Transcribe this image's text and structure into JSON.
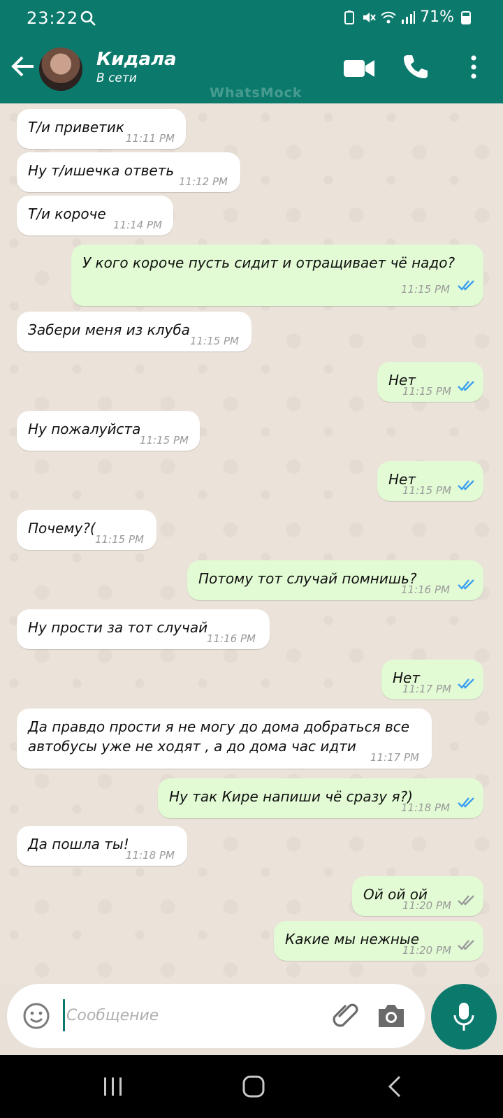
{
  "status_bar": {
    "time": "23:22",
    "battery": "71%",
    "icons": [
      "search-icon",
      "battery-saver-icon",
      "mute-icon",
      "wifi-icon",
      "signal-icon",
      "battery-icon"
    ]
  },
  "header": {
    "contact_name": "Кидала",
    "contact_status": "В сети",
    "watermark": "WhatsMock",
    "icons": [
      "back-arrow-icon",
      "video-call-icon",
      "phone-icon",
      "more-vert-icon"
    ]
  },
  "messages": [
    {
      "dir": "in",
      "text": "Т/и приветик",
      "time": "11:11 PM"
    },
    {
      "dir": "in",
      "text": "Ну т/ишечка ответь",
      "time": "11:12 PM"
    },
    {
      "dir": "in",
      "text": "Т/и короче",
      "time": "11:14 PM"
    },
    {
      "dir": "out",
      "text": "У кого короче пусть сидит и отращивает чё надо?",
      "time": "11:15 PM",
      "read": true
    },
    {
      "dir": "in",
      "text": "Забери меня из клуба",
      "time": "11:15 PM"
    },
    {
      "dir": "out",
      "text": "Нет",
      "time": "11:15 PM",
      "read": true
    },
    {
      "dir": "in",
      "text": "Ну пожалуйста",
      "time": "11:15 PM"
    },
    {
      "dir": "out",
      "text": "Нет",
      "time": "11:15 PM",
      "read": true
    },
    {
      "dir": "in",
      "text": "Почему?(",
      "time": "11:15 PM"
    },
    {
      "dir": "out",
      "text": "Потому тот случай помнишь?",
      "time": "11:16 PM",
      "read": true
    },
    {
      "dir": "in",
      "text": "Ну прости за тот случай",
      "time": "11:16 PM"
    },
    {
      "dir": "out",
      "text": "Нет",
      "time": "11:17 PM",
      "read": true
    },
    {
      "dir": "in",
      "text": "Да правдо прости я не могу до дома добраться все автобусы уже не ходят , а до дома час идти",
      "time": "11:17 PM"
    },
    {
      "dir": "out",
      "text": "Ну так Кире напиши чё сразу я?)",
      "time": "11:18 PM",
      "read": true
    },
    {
      "dir": "in",
      "text": "Да пошла ты!",
      "time": "11:18 PM"
    },
    {
      "dir": "out",
      "text": "Ой ой ой",
      "time": "11:20 PM",
      "read": false
    },
    {
      "dir": "out",
      "text": "Какие мы нежные",
      "time": "11:20 PM",
      "read": false
    }
  ],
  "composer": {
    "placeholder": "Сообщение",
    "value": ""
  },
  "colors": {
    "primary": "#0b7a6c",
    "incoming": "#ffffff",
    "outgoing": "#e2fbd4",
    "read_ticks": "#3b9ff0",
    "sent_ticks": "#9a9a9a"
  }
}
